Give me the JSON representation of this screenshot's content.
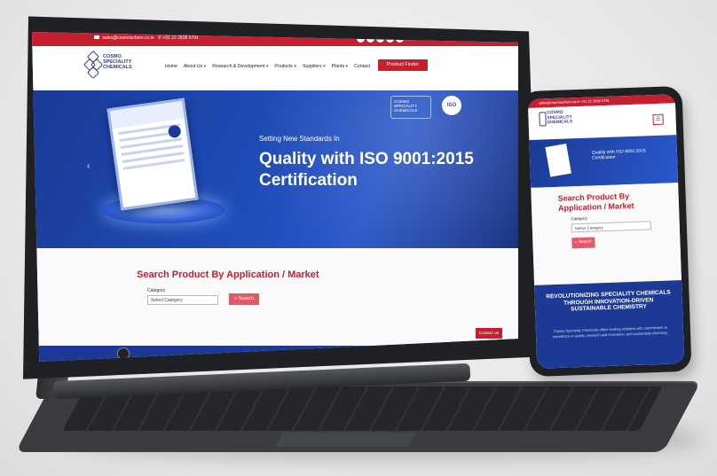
{
  "site": {
    "topbar": {
      "email": "sales@cosmoschem.co.in",
      "phone": "+91 22 2838 5791"
    },
    "socials": [
      "f",
      "in",
      "t",
      "yt",
      "ig"
    ],
    "logo_text": "COSMO SPECIALITY CHEMICALS",
    "nav": [
      "Home",
      "About Us",
      "Research & Development",
      "Products",
      "Suppliers",
      "Plants",
      "Contact"
    ],
    "product_finder": "Product Finder",
    "hero": {
      "kicker": "Setting New Standards In",
      "title": "Quality with ISO 9001:2015 Certification",
      "prev_arrow": "‹",
      "iso": "ISO"
    },
    "search": {
      "title": "Search Product By Application / Market",
      "category_label": "Category",
      "category_value": "Select Category",
      "button": "Search"
    },
    "chat": "Contact Us"
  },
  "phone": {
    "topbar": "sales@cosmoschem.co.in  +91 22 2838 5791",
    "logo_text": "COSMO SPECIALITY CHEMICALS",
    "menu_icon": "☰",
    "hero_text": "Quality with ISO 9001:2015 Certification",
    "search_title": "Search Product By Application / Market",
    "category_label": "Category",
    "category_value": "Select Category",
    "search_button": "Search",
    "banner_title": "REVOLUTIONIZING SPECIALITY CHEMICALS THROUGH INNOVATION-DRIVEN SUSTAINABLE CHEMISTRY",
    "banner_body": "Cosmo Speciality Chemicals offers leading solutions with commitment to excellence in quality, research and innovation, and sustainable chemistry."
  },
  "colors": {
    "brand_red": "#c51f30",
    "brand_blue": "#1c3a95"
  }
}
